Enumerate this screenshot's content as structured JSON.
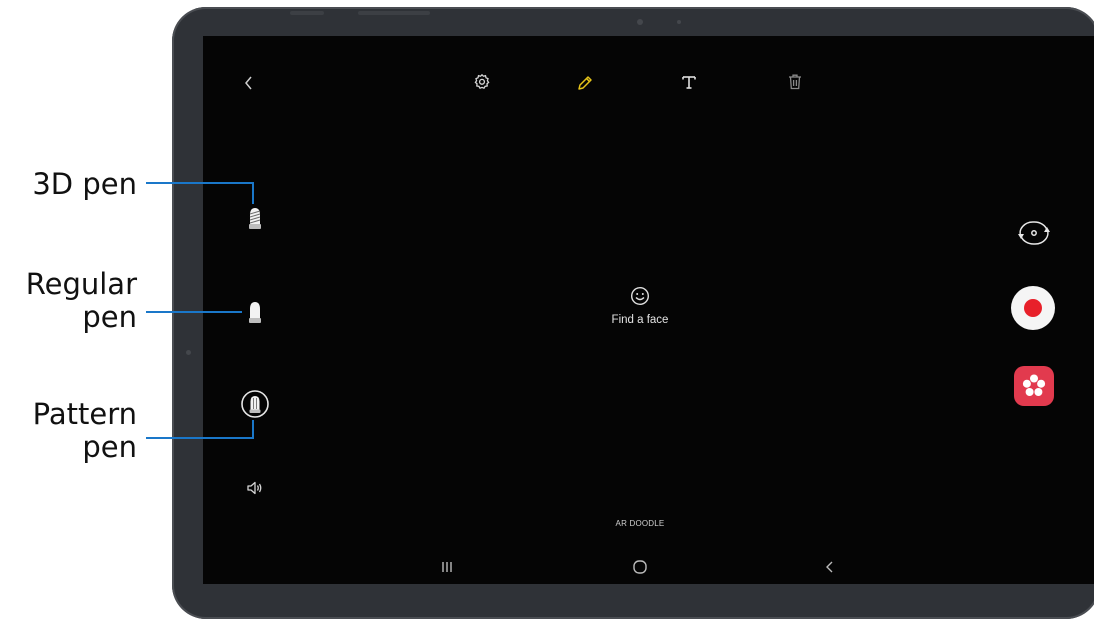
{
  "callouts": {
    "pen3d": "3D pen",
    "regular_line1": "Regular",
    "regular_line2": "pen",
    "pattern_line1": "Pattern",
    "pattern_line2": "pen"
  },
  "toolbar": {
    "back_icon": "back-arrow-icon",
    "settings_icon": "gear-icon",
    "draw_icon": "pencil-icon",
    "text_icon": "text-icon",
    "delete_icon": "trash-icon",
    "active_tool_color": "#e6c419"
  },
  "center": {
    "icon": "smiley-face-icon",
    "message": "Find a face"
  },
  "pens": {
    "items": [
      "3D pen",
      "Regular pen",
      "Pattern pen"
    ],
    "sound_icon": "speaker-icon"
  },
  "camera_controls": {
    "switch_icon": "camera-switch-icon",
    "record_icon": "record-icon",
    "record_color": "#e8202a",
    "effects_icon": "effects-icon",
    "effects_color": "#e23a4e"
  },
  "mode_label": "AR DOODLE",
  "nav_bar": {
    "recents_icon": "recents-icon",
    "home_icon": "home-icon",
    "back_icon": "back-icon"
  },
  "colors": {
    "callout_line": "#1a77c9",
    "screen": "#050505",
    "frame": "#2f3237"
  }
}
